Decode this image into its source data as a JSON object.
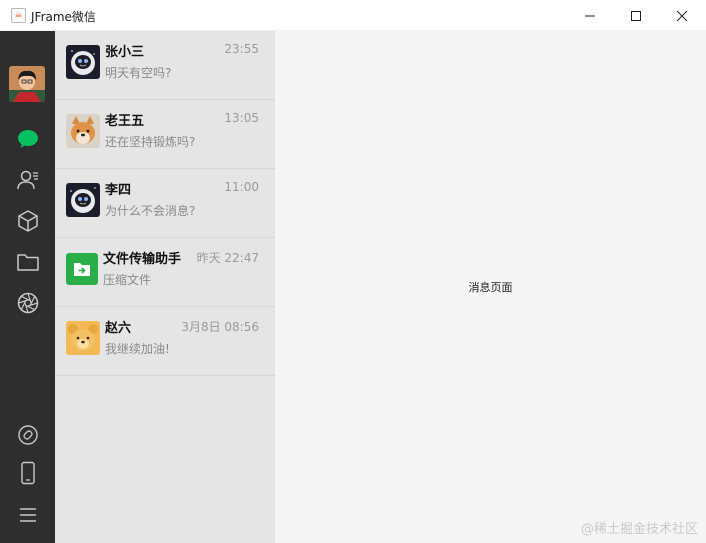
{
  "window": {
    "title": "JFrame微信",
    "app_icon_glyph": "☕"
  },
  "sidebar": {
    "items": [
      {
        "name": "chat",
        "icon": "chat-bubble-icon",
        "active": true,
        "color": "#07c160"
      },
      {
        "name": "contacts",
        "icon": "contacts-icon"
      },
      {
        "name": "collections",
        "icon": "cube-icon"
      },
      {
        "name": "files",
        "icon": "folder-icon"
      },
      {
        "name": "moments",
        "icon": "aperture-icon"
      }
    ],
    "bottom_items": [
      {
        "name": "mini-programs",
        "icon": "link-circle-icon"
      },
      {
        "name": "phone",
        "icon": "phone-icon"
      },
      {
        "name": "menu",
        "icon": "menu-icon"
      }
    ]
  },
  "conversations": [
    {
      "name": "张小三",
      "time": "23:55",
      "message": "明天有空吗?",
      "avatar": "astronaut"
    },
    {
      "name": "老王五",
      "time": "13:05",
      "message": "还在坚持锻炼吗?",
      "avatar": "dog"
    },
    {
      "name": "李四",
      "time": "11:00",
      "message": "为什么不会消息?",
      "avatar": "astronaut"
    },
    {
      "name": "文件传输助手",
      "time": "昨天 22:47",
      "message": "压缩文件",
      "avatar": "file-transfer"
    },
    {
      "name": "赵六",
      "time": "3月8日 08:56",
      "message": "我继续加油!",
      "avatar": "bear"
    }
  ],
  "main": {
    "placeholder": "消息页面"
  },
  "watermark": "@稀土掘金技术社区",
  "colors": {
    "sidebar_bg": "#2e2e2e",
    "list_bg": "#e5e5e5",
    "main_bg": "#f5f5f5",
    "accent": "#07c160"
  }
}
